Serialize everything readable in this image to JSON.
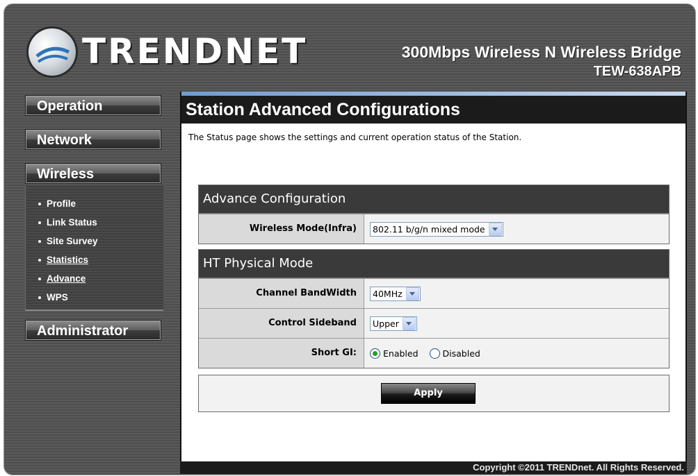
{
  "brand": {
    "logo_text": "TRENDnET",
    "logo_display": "TRENDNET"
  },
  "header": {
    "product_line": "300Mbps Wireless N Wireless Bridge",
    "model": "TEW-638APB"
  },
  "sidebar": {
    "menu": [
      {
        "label": "Operation"
      },
      {
        "label": "Network"
      },
      {
        "label": "Wireless"
      },
      {
        "label": "Administrator"
      }
    ],
    "wireless_items": [
      {
        "label": "Profile"
      },
      {
        "label": "Link Status"
      },
      {
        "label": "Site Survey"
      },
      {
        "label": "Statistics"
      },
      {
        "label": "Advance"
      },
      {
        "label": "WPS"
      }
    ]
  },
  "main": {
    "title": "Station Advanced Configurations",
    "description": "The Status page shows the settings and current operation status of the Station.",
    "advance_section": {
      "title": "Advance Configuration",
      "wireless_mode_label": "Wireless Mode(Infra)",
      "wireless_mode_value": "802.11 b/g/n mixed mode"
    },
    "ht_section": {
      "title": "HT Physical Mode",
      "channel_bandwidth_label": "Channel BandWidth",
      "channel_bandwidth_value": "40MHz",
      "control_sideband_label": "Control Sideband",
      "control_sideband_value": "Upper",
      "short_gi_label": "Short GI:",
      "short_gi_enabled_label": "Enabled",
      "short_gi_disabled_label": "Disabled",
      "short_gi_selected": "Enabled"
    },
    "apply_label": "Apply"
  },
  "footer": {
    "copyright": "Copyright ©2011 TRENDnet. All Rights Reserved."
  }
}
